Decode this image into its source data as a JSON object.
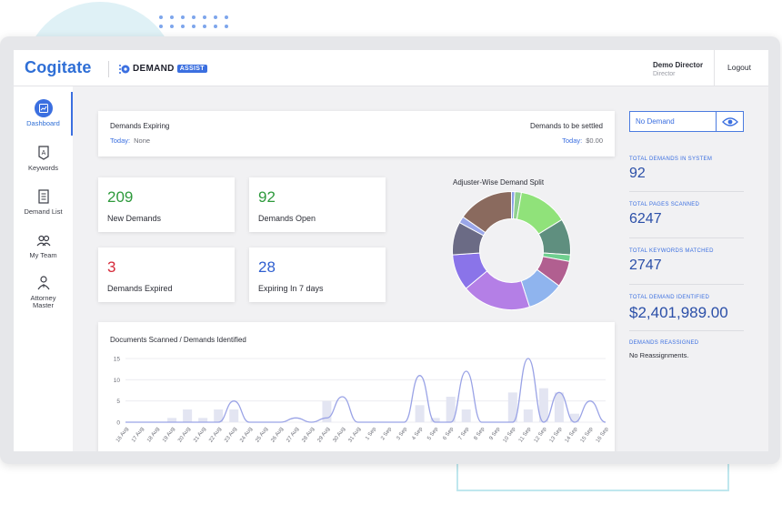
{
  "header": {
    "logo": "Cogitate",
    "brand_name": "DEMAND",
    "brand_badge": "ASSIST",
    "user_name": "Demo Director",
    "user_role": "Director",
    "logout_label": "Logout"
  },
  "sidebar": {
    "items": [
      {
        "label": "Dashboard",
        "icon": "dashboard-icon",
        "active": true
      },
      {
        "label": "Keywords",
        "icon": "keywords-icon",
        "active": false
      },
      {
        "label": "Demand List",
        "icon": "demand-list-icon",
        "active": false
      },
      {
        "label": "My Team",
        "icon": "team-icon",
        "active": false
      },
      {
        "label": "Attorney Master",
        "icon": "attorney-icon",
        "active": false
      }
    ]
  },
  "expiring": {
    "title": "Demands Expiring",
    "today_label": "Today:",
    "today_value": "None",
    "settle_title": "Demands to be settled",
    "settle_today_label": "Today:",
    "settle_today_value": "$0.00"
  },
  "stats": [
    {
      "value": "209",
      "label": "New Demands",
      "color": "#2e9a3c"
    },
    {
      "value": "92",
      "label": "Demands Open",
      "color": "#2e9a3c"
    },
    {
      "value": "3",
      "label": "Demands Expired",
      "color": "#d62a3a"
    },
    {
      "value": "28",
      "label": "Expiring In 7 days",
      "color": "#2f5fd0"
    }
  ],
  "pie": {
    "title": "Adjuster-Wise Demand Split",
    "slices": [
      {
        "value": 1,
        "color": "#8aa0e8"
      },
      {
        "value": 2,
        "color": "#8fd08f"
      },
      {
        "value": 15,
        "color": "#90e27a"
      },
      {
        "value": 11,
        "color": "#5f8f7f"
      },
      {
        "value": 2,
        "color": "#6fcf8f"
      },
      {
        "value": 8,
        "color": "#b15f90"
      },
      {
        "value": 11,
        "color": "#8fb4ee"
      },
      {
        "value": 21,
        "color": "#b47fe6"
      },
      {
        "value": 11,
        "color": "#8a74e9"
      },
      {
        "value": 10,
        "color": "#6b6b85"
      },
      {
        "value": 2,
        "color": "#9aa6e8"
      },
      {
        "value": 17,
        "color": "#8a6a5e"
      }
    ]
  },
  "right_panel": {
    "select_value": "No Demand",
    "blocks": [
      {
        "label": "TOTAL DEMANDS IN SYSTEM",
        "value": "92"
      },
      {
        "label": "TOTAL PAGES SCANNED",
        "value": "6247"
      },
      {
        "label": "TOTAL KEYWORDS MATCHED",
        "value": "2747"
      },
      {
        "label": "TOTAL DEMAND IDENTIFIED",
        "value": "$2,401,989.00"
      }
    ],
    "reassigned_label": "DEMANDS REASSIGNED",
    "reassigned_text": "No Reassignments."
  },
  "chart_data": {
    "type": "bar",
    "title": "Documents Scanned / Demands Identified",
    "categories": [
      "16 Aug",
      "17 Aug",
      "18 Aug",
      "19 Aug",
      "20 Aug",
      "21 Aug",
      "22 Aug",
      "23 Aug",
      "24 Aug",
      "25 Aug",
      "26 Aug",
      "27 Aug",
      "28 Aug",
      "29 Aug",
      "30 Aug",
      "31 Aug",
      "1 Sep",
      "2 Sep",
      "3 Sep",
      "4 Sep",
      "5 Sep",
      "6 Sep",
      "7 Sep",
      "8 Sep",
      "9 Sep",
      "10 Sep",
      "11 Sep",
      "12 Sep",
      "13 Sep",
      "14 Sep",
      "15 Sep",
      "16 Sep"
    ],
    "ylim": [
      0,
      15
    ],
    "yticks": [
      0,
      5,
      10,
      15
    ],
    "series": [
      {
        "type": "bar",
        "values": [
          0,
          0,
          0,
          1,
          3,
          1,
          3,
          3,
          0,
          0,
          0,
          0,
          0,
          5,
          0,
          0,
          0,
          0,
          0,
          4,
          1,
          6,
          3,
          0,
          0,
          7,
          3,
          8,
          7,
          2,
          0,
          0
        ],
        "color": "#e3e5f2"
      },
      {
        "type": "line",
        "values": [
          0,
          0,
          0,
          0,
          0,
          0,
          0,
          5,
          0,
          0,
          0,
          1,
          0,
          1,
          6,
          0,
          0,
          0,
          0,
          11,
          0,
          0,
          12,
          0,
          0,
          0,
          15,
          0,
          7,
          0,
          5,
          0
        ],
        "color": "#9aa3e6"
      }
    ]
  }
}
